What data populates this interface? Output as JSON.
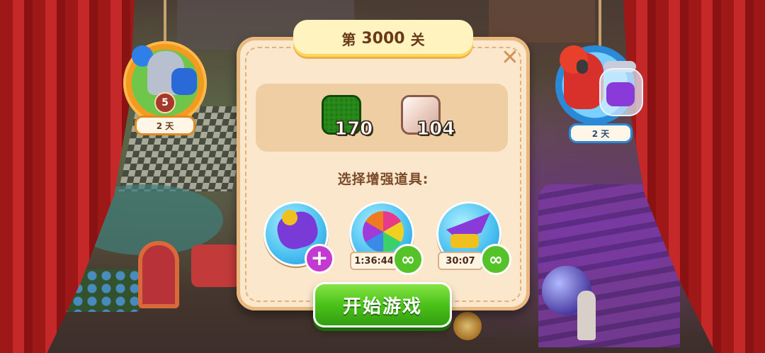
{
  "dialog": {
    "title_prefix": "第",
    "level": "3000",
    "title_suffix": "关",
    "close_label": "✕",
    "goals": [
      {
        "icon": "green-grass-tile-icon",
        "count": "170"
      },
      {
        "icon": "pink-tile-icon",
        "count": "104"
      }
    ],
    "boosters_label": "选择增强道具:",
    "boosters": [
      {
        "icon": "rocket-booster-icon",
        "badge": "+",
        "timer": ""
      },
      {
        "icon": "rainbow-ball-booster-icon",
        "badge": "∞",
        "timer": "1:36:44"
      },
      {
        "icon": "paper-plane-booster-icon",
        "badge": "∞",
        "timer": "30:07"
      }
    ],
    "start_label": "开始游戏"
  },
  "left_event": {
    "icon": "knight-event-icon",
    "level": "5",
    "days": "2 天"
  },
  "right_event": {
    "icon": "parrot-jar-event-icon",
    "days": "2 天"
  },
  "colors": {
    "dialog_bg": "#fbe8cc",
    "start_button": "#4cc21a",
    "curtain": "#b82020"
  }
}
